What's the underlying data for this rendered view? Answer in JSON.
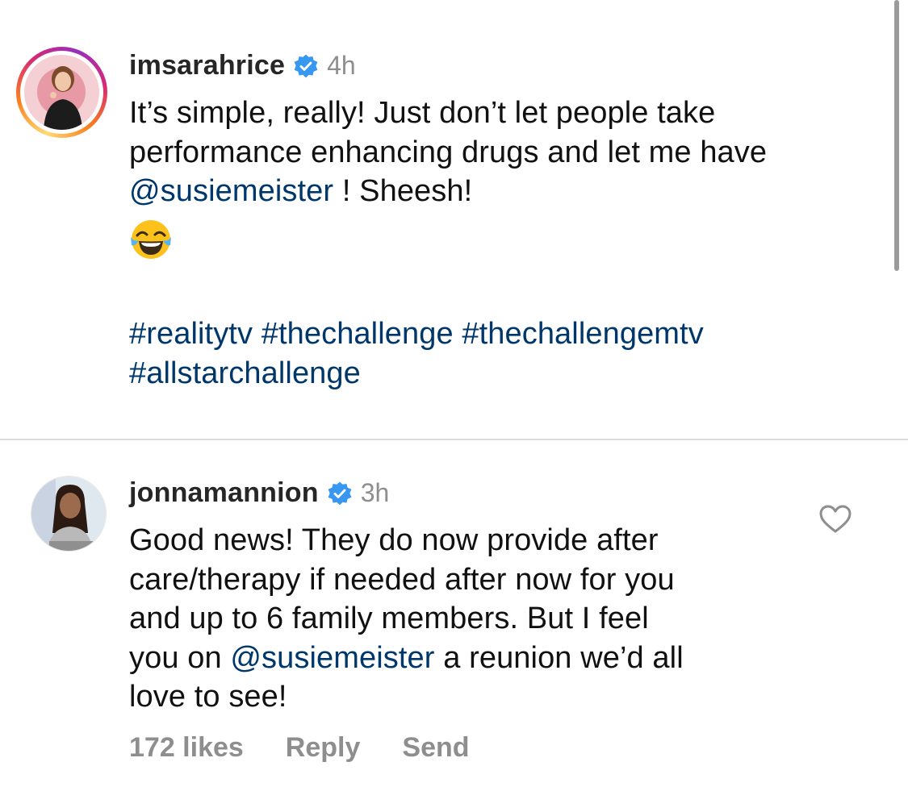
{
  "comments": [
    {
      "username": "imsarahrice",
      "time": "4h",
      "text_line1": "It’s simple, really!  Just don’t let people take",
      "text_line2": "performance enhancing drugs and let me have",
      "mention": "@susiemeister",
      "after_mention": " ! Sheesh!",
      "emoji_icon": "face-with-tears-of-joy-icon",
      "hashtags_line1": [
        "#realitytv",
        "#thechallenge",
        "#thechallengemtv"
      ],
      "hashtags_line2": [
        "#allstarchallenge"
      ]
    },
    {
      "username": "jonnamannion",
      "time": "3h",
      "text_line1": "Good news! They do now provide after",
      "text_line2": "care/therapy if needed after now for you",
      "text_line3": "and up to 6 family members. But I feel",
      "text_line4_pre": "you on ",
      "mention": "@susiemeister",
      "text_line4_post": " a reunion we’d all",
      "text_line5": "love to see!",
      "likes": "172 likes",
      "reply_label": "Reply",
      "send_label": "Send"
    }
  ],
  "colors": {
    "link": "#00376b",
    "verified": "#3897f0",
    "secondary": "#8e8e8e"
  }
}
